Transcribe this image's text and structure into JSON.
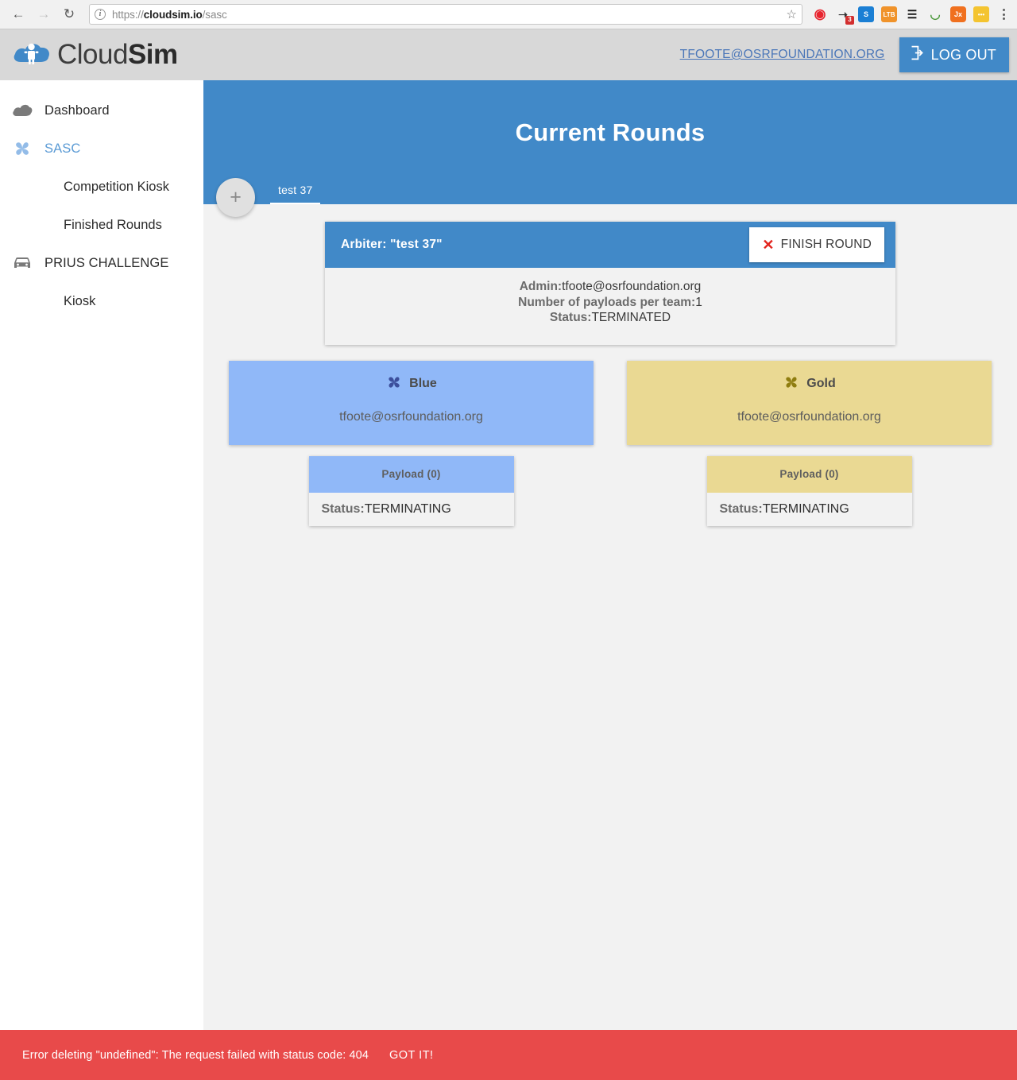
{
  "browser": {
    "back_icon": "back-arrow-icon",
    "forward_icon": "forward-arrow-icon",
    "reload_icon": "reload-icon",
    "site_info_icon": "info-icon",
    "url_scheme": "https://",
    "url_host": "cloudsim.io",
    "url_path": "/sasc",
    "url_full": "https://cloudsim.io/sasc",
    "bookmark_icon": "star-icon",
    "extensions": [
      {
        "name": "shield-extension-icon",
        "glyph": "◐",
        "color": "#e8242e",
        "bg": "transparent",
        "badge": ""
      },
      {
        "name": "sneaker-extension-icon",
        "glyph": "👟",
        "color": "#333333",
        "bg": "transparent",
        "badge": "3"
      },
      {
        "name": "s-extension-icon",
        "glyph": "S",
        "color": "#ffffff",
        "bg": "#1b7fd4",
        "badge": ""
      },
      {
        "name": "ltb-extension-icon",
        "glyph": "LTB",
        "color": "#ffffff",
        "bg": "#f0932b",
        "badge": ""
      },
      {
        "name": "database-extension-icon",
        "glyph": "☰",
        "color": "#141414",
        "bg": "transparent",
        "badge": ""
      },
      {
        "name": "rainbow-extension-icon",
        "glyph": "◠",
        "color": "#4e9a3e",
        "bg": "transparent",
        "badge": ""
      },
      {
        "name": "jx-extension-icon",
        "glyph": "Jx",
        "color": "#ffffff",
        "bg": "#f0701f",
        "badge": ""
      },
      {
        "name": "dots-extension-icon",
        "glyph": "•••",
        "color": "#ffffff",
        "bg": "#f4c430",
        "badge": ""
      }
    ],
    "menu_icon": "kebab-menu-icon"
  },
  "header": {
    "brand_light": "Cloud",
    "brand_bold": "Sim",
    "logo_icon": "cloudsim-logo-icon",
    "user_email": "TFOOTE@OSRFOUNDATION.ORG",
    "logout_label": "LOG OUT",
    "logout_icon": "logout-icon"
  },
  "sidebar": {
    "items": [
      {
        "label": "Dashboard",
        "icon": "cloud-icon",
        "type": "top",
        "active": false
      },
      {
        "label": "SASC",
        "icon": "pinwheel-icon",
        "type": "top",
        "active": true
      },
      {
        "label": "Competition Kiosk",
        "icon": "",
        "type": "sub",
        "active": false
      },
      {
        "label": "Finished Rounds",
        "icon": "",
        "type": "sub",
        "active": false
      },
      {
        "label": "PRIUS CHALLENGE",
        "icon": "car-icon",
        "type": "top",
        "active": false
      },
      {
        "label": "Kiosk",
        "icon": "",
        "type": "sub",
        "active": false
      }
    ]
  },
  "page": {
    "title": "Current Rounds",
    "add_round_label": "+",
    "add_round_icon": "plus-icon",
    "tabs": [
      {
        "label": "test 37",
        "active": true
      }
    ]
  },
  "arbiter": {
    "title": "Arbiter: \"test 37\"",
    "finish_label": "FINISH ROUND",
    "finish_icon": "close-x-icon",
    "fields": [
      {
        "label": "Admin:",
        "value": "tfoote@osrfoundation.org"
      },
      {
        "label": "Number of payloads per team:",
        "value": "1"
      },
      {
        "label": "Status:",
        "value": "TERMINATED"
      }
    ]
  },
  "teams": [
    {
      "name": "Blue",
      "icon": "pinwheel-icon",
      "email": "tfoote@osrfoundation.org",
      "card_color": "#90b8f8",
      "icon_color": "#3c4f9c",
      "payload": {
        "header": "Payload (0)",
        "status_label": "Status:",
        "status_value": "TERMINATING"
      }
    },
    {
      "name": "Gold",
      "icon": "pinwheel-icon",
      "email": "tfoote@osrfoundation.org",
      "card_color": "#ead993",
      "icon_color": "#8f7d10",
      "payload": {
        "header": "Payload (0)",
        "status_label": "Status:",
        "status_value": "TERMINATING"
      }
    }
  ],
  "snackbar": {
    "message": "Error deleting \"undefined\": The request failed with status code: 404",
    "action_label": "GOT IT!",
    "color": "#e84a4a"
  }
}
